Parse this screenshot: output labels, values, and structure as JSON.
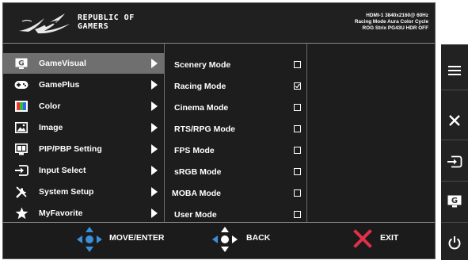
{
  "header": {
    "brand_line1": "REPUBLIC OF",
    "brand_line2": "GAMERS",
    "status_line1": "HDMI-1 3840x2160@ 60Hz",
    "status_line2": "Racing Mode Aura Color Cycle",
    "status_line3": "ROG Strix PG43U HDR OFF"
  },
  "menu": {
    "items": [
      {
        "label": "GameVisual",
        "icon": "gamevisual-icon",
        "selected": true
      },
      {
        "label": "GamePlus",
        "icon": "gamepad-icon",
        "selected": false
      },
      {
        "label": "Color",
        "icon": "color-icon",
        "selected": false
      },
      {
        "label": "Image",
        "icon": "image-icon",
        "selected": false
      },
      {
        "label": "PIP/PBP Setting",
        "icon": "pip-pbp-icon",
        "selected": false
      },
      {
        "label": "Input Select",
        "icon": "input-select-icon",
        "selected": false
      },
      {
        "label": "System Setup",
        "icon": "system-setup-icon",
        "selected": false
      },
      {
        "label": "MyFavorite",
        "icon": "star-icon",
        "selected": false
      }
    ]
  },
  "submenu": {
    "items": [
      {
        "label": "Scenery Mode",
        "checked": false
      },
      {
        "label": "Racing Mode",
        "checked": true
      },
      {
        "label": "Cinema Mode",
        "checked": false
      },
      {
        "label": "RTS/RPG Mode",
        "checked": false
      },
      {
        "label": "FPS Mode",
        "checked": false
      },
      {
        "label": "sRGB Mode",
        "checked": false
      },
      {
        "label": "MOBA Mode",
        "checked": false
      },
      {
        "label": "User Mode",
        "checked": false
      }
    ]
  },
  "footer": {
    "move_enter": "MOVE/ENTER",
    "back": "BACK",
    "exit": "EXIT"
  },
  "side_keys": [
    "menu-icon",
    "close-icon",
    "input-icon",
    "gamevisual-key-icon",
    "power-icon"
  ],
  "colors": {
    "selected_bg": "#6f6f6f",
    "nav_blue": "#3a8fd8",
    "exit_red": "#e0304a"
  }
}
